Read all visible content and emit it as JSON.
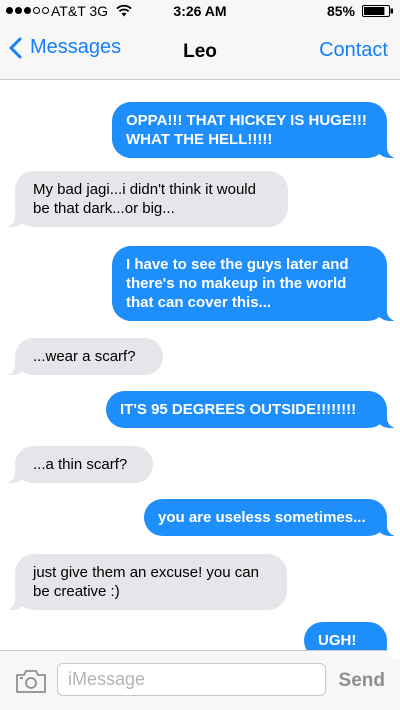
{
  "status_bar": {
    "carrier": "AT&T 3G",
    "time": "3:26 AM",
    "battery": "85%",
    "battery_level": 0.85,
    "signal_bars": 3,
    "signal_total": 5
  },
  "nav": {
    "back_label": "Messages",
    "title": "Leo",
    "contact_label": "Contact"
  },
  "messages": [
    {
      "side": "sent",
      "text": "OPPA!!! THAT HICKEY IS HUGE!!! WHAT THE HELL!!!!!"
    },
    {
      "side": "received",
      "text": "My bad jagi...i didn't think it would be that dark...or big..."
    },
    {
      "side": "sent",
      "text": "I have to see the guys later and there's no makeup in the world that can cover this..."
    },
    {
      "side": "received",
      "text": "...wear a scarf?"
    },
    {
      "side": "sent",
      "text": "IT'S 95 DEGREES OUTSIDE!!!!!!!!"
    },
    {
      "side": "received",
      "text": "...a thin scarf?"
    },
    {
      "side": "sent",
      "text": "you are useless sometimes..."
    },
    {
      "side": "received",
      "text": "just give them an excuse! you can be creative :)"
    },
    {
      "side": "sent",
      "text": "UGH!"
    }
  ],
  "input": {
    "placeholder": "iMessage",
    "value": "",
    "send_label": "Send"
  },
  "colors": {
    "sent_bubble": "#1e8efb",
    "received_bubble": "#e5e5ea",
    "accent": "#147efb"
  },
  "icons": {
    "camera": "camera-icon",
    "back": "chevron-left-icon",
    "wifi": "wifi-icon",
    "battery": "battery-icon"
  }
}
